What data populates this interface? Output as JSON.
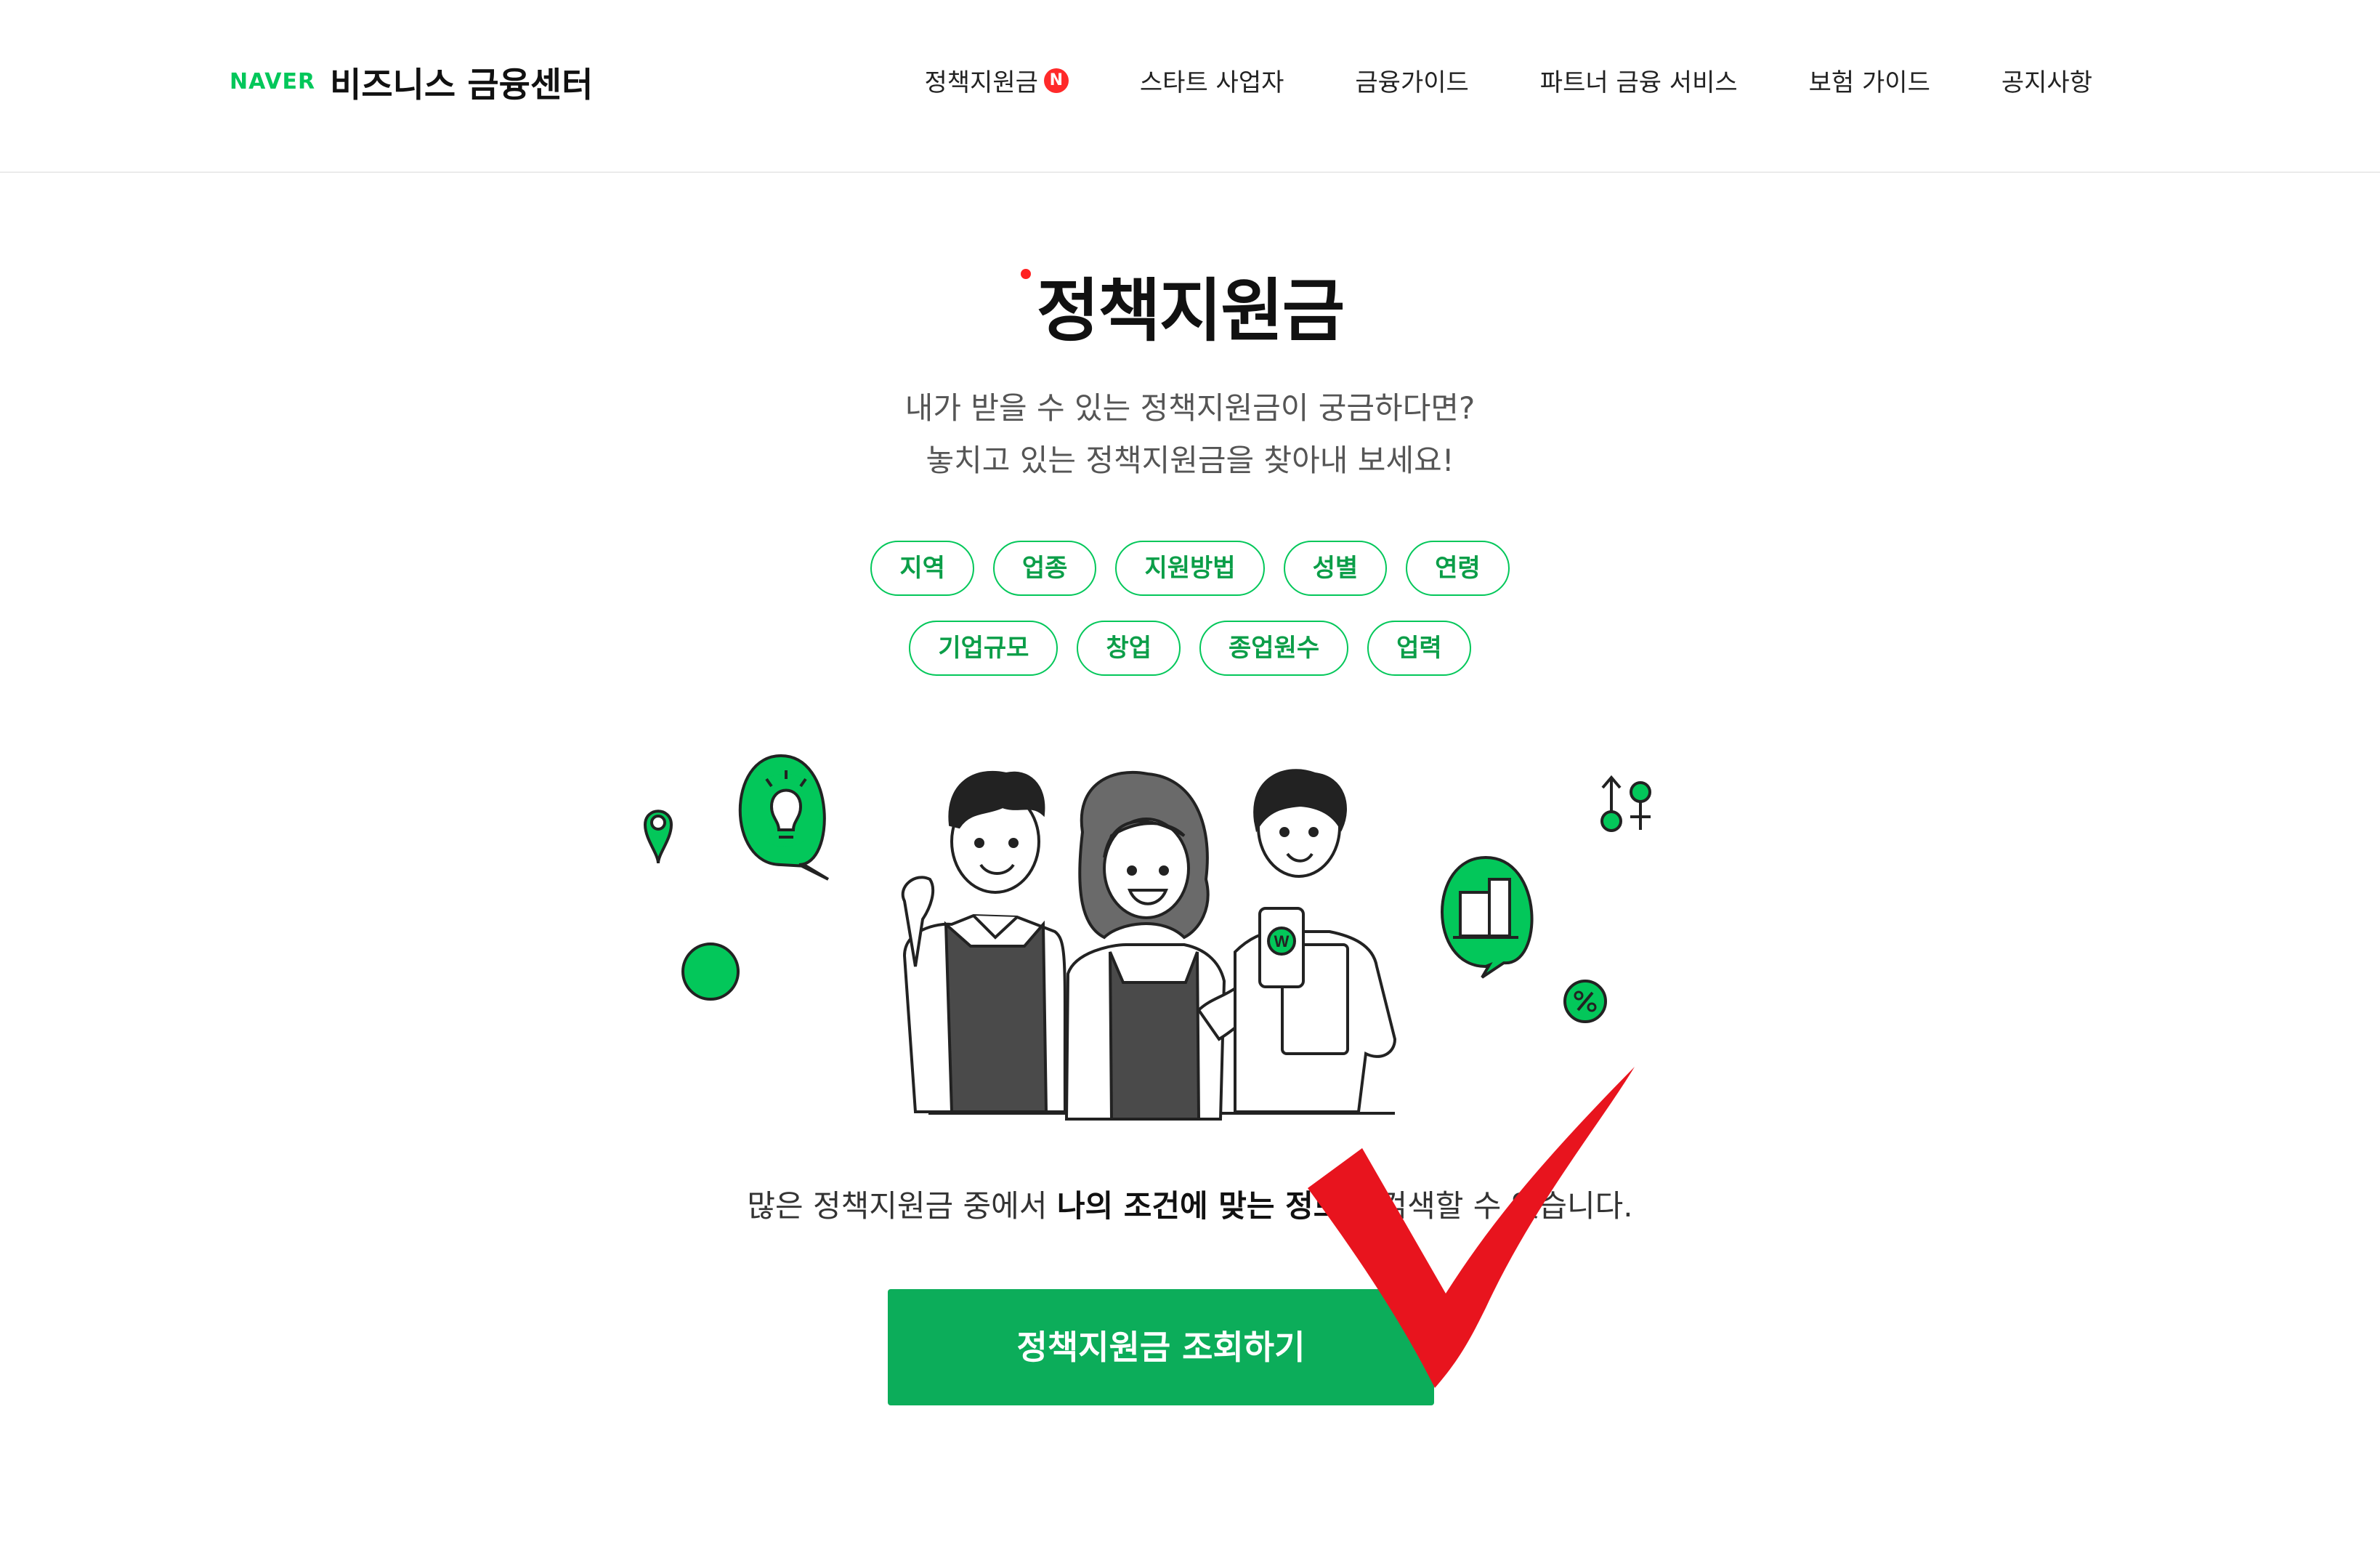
{
  "header": {
    "logo_mark": "NAVER",
    "logo_title": "비즈니스 금융센터",
    "nav": [
      {
        "label": "정책지원금",
        "badge": "N"
      },
      {
        "label": "스타트 사업자"
      },
      {
        "label": "금융가이드"
      },
      {
        "label": "파트너 금융 서비스"
      },
      {
        "label": "보험 가이드"
      },
      {
        "label": "공지사항"
      }
    ]
  },
  "main": {
    "title": "정책지원금",
    "subtitle_line1": "내가 받을 수 있는 정책지원금이 궁금하다면?",
    "subtitle_line2": "놓치고 있는 정책지원금을 찾아내 보세요!",
    "tags_row1": [
      "지역",
      "업종",
      "지원방법",
      "성별",
      "연령"
    ],
    "tags_row2": [
      "기업규모",
      "창업",
      "종업원수",
      "업력"
    ],
    "desc_pre": "많은 정책지원금 중에서 ",
    "desc_bold": "나의 조건에 맞는 정보",
    "desc_post": "를 검색할 수 있습니다.",
    "cta": "정책지원금 조회하기",
    "phone_badge": "W"
  },
  "colors": {
    "brand_green": "#03c75a",
    "cta_green": "#0cad5a",
    "badge_red": "#ff2a2a",
    "check_red": "#e8141e"
  }
}
